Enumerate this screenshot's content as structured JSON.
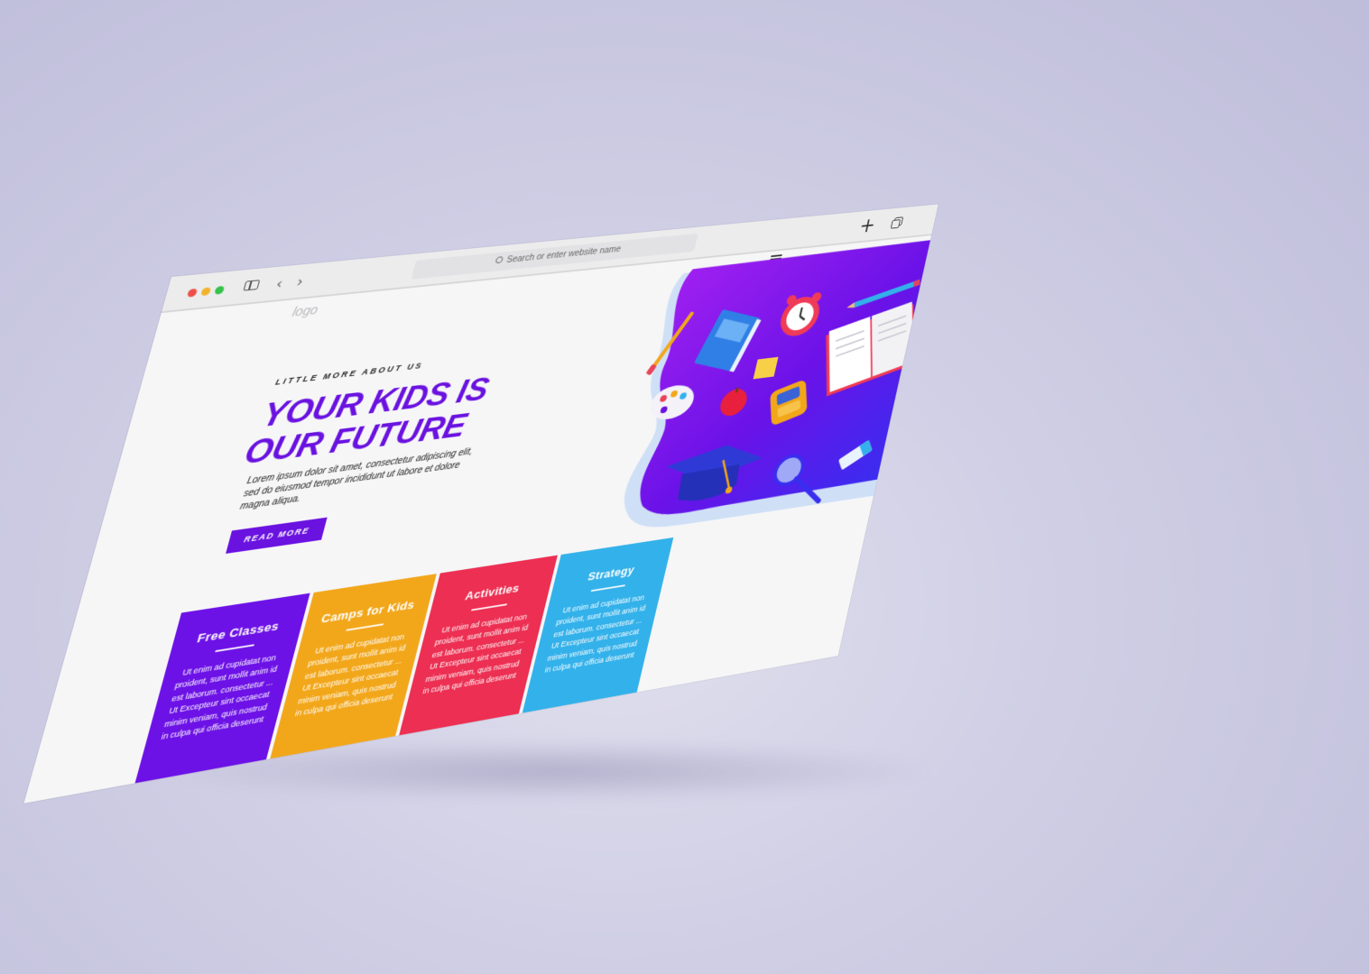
{
  "browser": {
    "address_placeholder": "Search or enter website name"
  },
  "site": {
    "logo": "logo",
    "hero": {
      "eyebrow": "LITTLE MORE ABOUT US",
      "title_line1": "YOUR KIDS IS",
      "title_line2": "OUR FUTURE",
      "body": "Lorem ipsum dolor sit amet, consectetur adipiscing elit, sed do eiusmod tempor incididunt ut labore et dolore magna aliqua.",
      "button": "READ MORE"
    },
    "cards": [
      {
        "title": "Free Classes",
        "text_line1": "Ut enim ad cupidatat non proident, sunt mollit anim id est laborum. consectetur ...",
        "text_line2": "Ut Excepteur sint occaecat minim veniam, quis nostrud in culpa qui officia deserunt",
        "color": "#6d12e6"
      },
      {
        "title": "Camps for Kids",
        "text_line1": "Ut enim ad cupidatat non proident, sunt mollit anim id est laborum. consectetur ...",
        "text_line2": "Ut Excepteur sint occaecat minim veniam, quis nostrud in culpa qui officia deserunt",
        "color": "#f2a71b"
      },
      {
        "title": "Activities",
        "text_line1": "Ut enim ad cupidatat non proident, sunt mollit anim id est laborum. consectetur ...",
        "text_line2": "Ut Excepteur sint occaecat minim veniam, quis nostrud in culpa qui officia deserunt",
        "color": "#ec2f52"
      },
      {
        "title": "Strategy",
        "text_line1": "Ut enim ad cupidatat non proident, sunt mollit anim id est laborum. consectetur ...",
        "text_line2": "Ut Excepteur sint occaecat minim veniam, quis nostrud in culpa qui officia deserunt",
        "color": "#33b1ea"
      }
    ]
  },
  "theme": {
    "accent": "#6a12e0",
    "background": "#c9c8e0"
  },
  "icons": [
    "sidebar-toggle-icon",
    "back-arrow-icon",
    "forward-arrow-icon",
    "search-icon",
    "new-tab-plus-icon",
    "tabs-overview-icon",
    "hamburger-menu-icon"
  ]
}
